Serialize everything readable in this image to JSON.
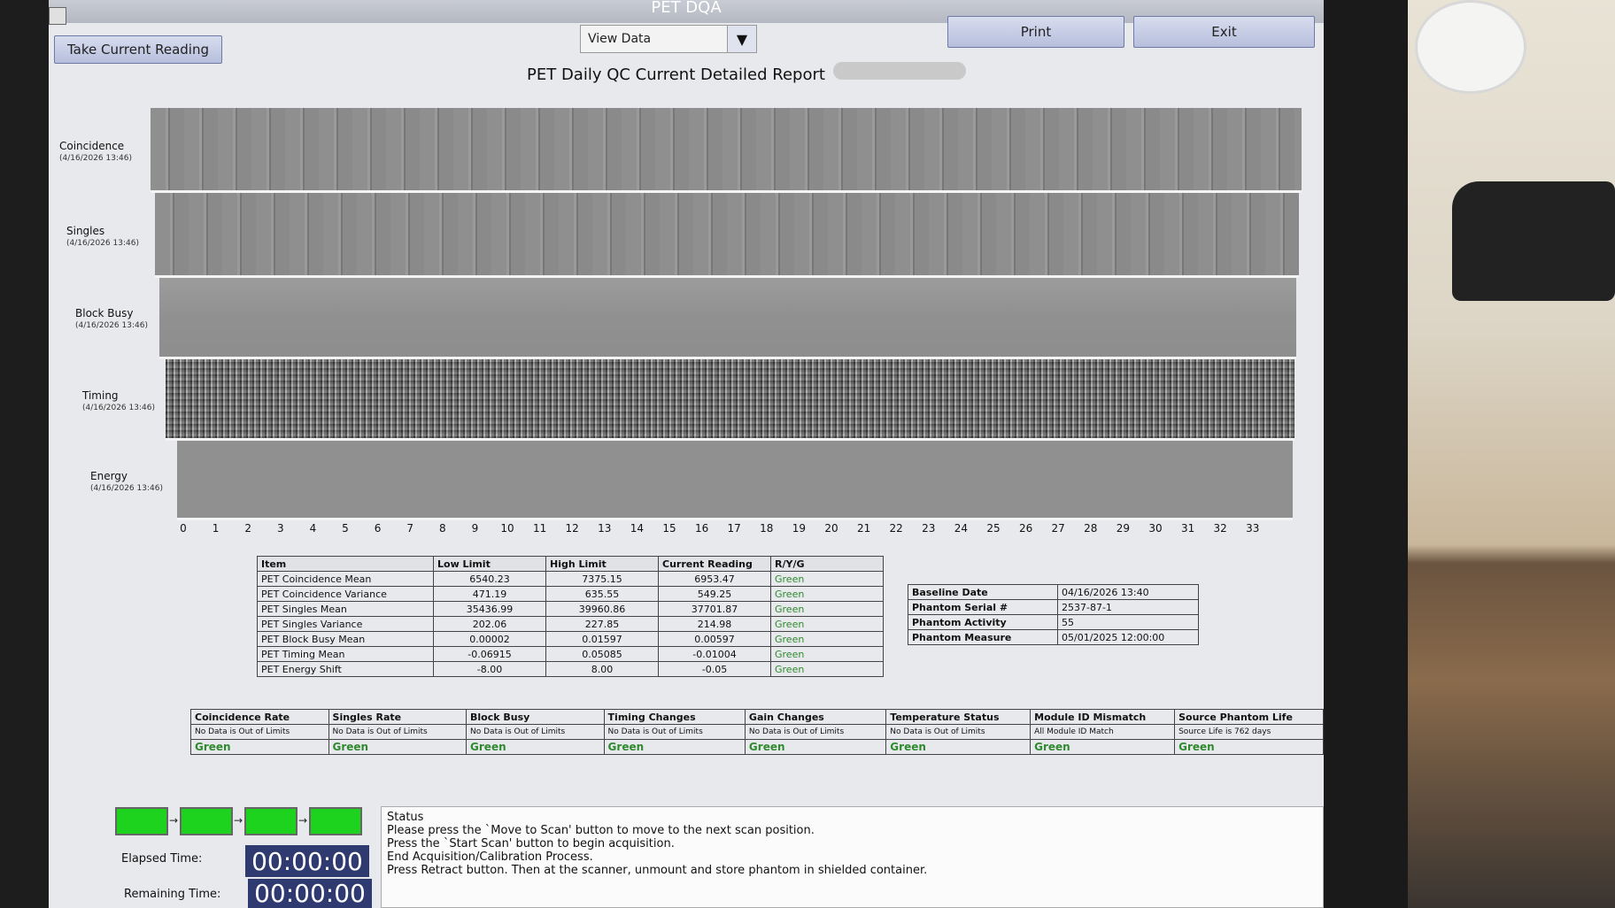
{
  "window": {
    "title": "PET DQA"
  },
  "toolbar": {
    "take_reading_label": "Take Current Reading",
    "view_select_value": "View Data",
    "print_label": "Print",
    "exit_label": "Exit"
  },
  "report": {
    "title": "PET Daily QC Current Detailed Report"
  },
  "panels": [
    {
      "label": "Coincidence",
      "timestamp": "(4/16/2026 13:46)"
    },
    {
      "label": "Singles",
      "timestamp": "(4/16/2026 13:46)"
    },
    {
      "label": "Block Busy",
      "timestamp": "(4/16/2026 13:46)"
    },
    {
      "label": "Timing",
      "timestamp": "(4/16/2026 13:46)"
    },
    {
      "label": "Energy",
      "timestamp": "(4/16/2026 13:46)"
    }
  ],
  "axis_ticks": [
    "0",
    "1",
    "2",
    "3",
    "4",
    "5",
    "6",
    "7",
    "8",
    "9",
    "10",
    "11",
    "12",
    "13",
    "14",
    "15",
    "16",
    "17",
    "18",
    "19",
    "20",
    "21",
    "22",
    "23",
    "24",
    "25",
    "26",
    "27",
    "28",
    "29",
    "30",
    "31",
    "32",
    "33"
  ],
  "results_table": {
    "headers": [
      "Item",
      "Low Limit",
      "High Limit",
      "Current Reading",
      "R/Y/G"
    ],
    "rows": [
      [
        "PET Coincidence Mean",
        "6540.23",
        "7375.15",
        "6953.47",
        "Green"
      ],
      [
        "PET Coincidence Variance",
        "471.19",
        "635.55",
        "549.25",
        "Green"
      ],
      [
        "PET Singles Mean",
        "35436.99",
        "39960.86",
        "37701.87",
        "Green"
      ],
      [
        "PET Singles Variance",
        "202.06",
        "227.85",
        "214.98",
        "Green"
      ],
      [
        "PET Block Busy Mean",
        "0.00002",
        "0.01597",
        "0.00597",
        "Green"
      ],
      [
        "PET Timing Mean",
        "-0.06915",
        "0.05085",
        "-0.01004",
        "Green"
      ],
      [
        "PET Energy Shift",
        "-8.00",
        "8.00",
        "-0.05",
        "Green"
      ]
    ]
  },
  "phantom_info": [
    {
      "key": "Baseline Date",
      "value": "04/16/2026 13:40"
    },
    {
      "key": "Phantom Serial #",
      "value": "2537-87-1"
    },
    {
      "key": "Phantom Activity",
      "value": "55"
    },
    {
      "key": "Phantom Measure",
      "value": "05/01/2025 12:00:00"
    }
  ],
  "status_table": {
    "headers": [
      "Coincidence Rate",
      "Singles Rate",
      "Block Busy",
      "Timing Changes",
      "Gain Changes",
      "Temperature Status",
      "Module ID Mismatch",
      "Source Phantom Life"
    ],
    "details": [
      "No Data is Out of Limits",
      "No Data is Out of Limits",
      "No Data is Out of Limits",
      "No Data is Out of Limits",
      "No Data is Out of Limits",
      "No Data is Out of Limits",
      "All Module ID Match",
      "Source Life is 762 days"
    ],
    "results": [
      "Green",
      "Green",
      "Green",
      "Green",
      "Green",
      "Green",
      "Green",
      "Green"
    ]
  },
  "progress": {
    "steps_complete": 4,
    "steps_total": 4,
    "step_color": "#1ed31e"
  },
  "timers": {
    "elapsed_label": "Elapsed Time:",
    "elapsed_value": "00:00:00",
    "remaining_label": "Remaining Time:",
    "remaining_value": "00:00:00"
  },
  "status_panel": {
    "header": "Status",
    "lines": [
      "Please press the `Move to Scan' button to move to the next scan position.",
      "Press the `Start Scan' button to begin acquisition.",
      "End Acquisition/Calibration Process.",
      "Press Retract button.  Then at the scanner, unmount and store phantom in shielded container."
    ]
  }
}
